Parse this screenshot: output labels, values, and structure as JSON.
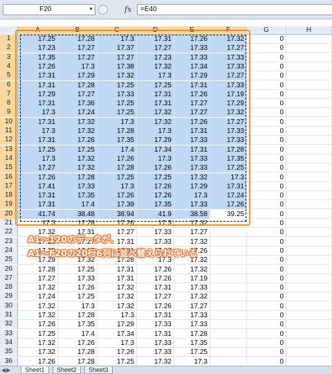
{
  "formula_bar": {
    "name_box": "F20",
    "fx_label": "fx",
    "formula": "=E40"
  },
  "columns": [
    "A",
    "B",
    "C",
    "D",
    "E",
    "F",
    "G",
    "H"
  ],
  "rows": [
    [
      "17.25",
      "17.28",
      "17.3",
      "17.31",
      "17.26",
      "17.32",
      "0"
    ],
    [
      "17.23",
      "17.27",
      "17.37",
      "17.27",
      "17.33",
      "17.27",
      "0"
    ],
    [
      "17.35",
      "17.27",
      "17.27",
      "17.23",
      "17.33",
      "17.33",
      "0"
    ],
    [
      "17.26",
      "17.3",
      "17.38",
      "17.32",
      "17.34",
      "17.33",
      "0"
    ],
    [
      "17.31",
      "17.29",
      "17.32",
      "17.3",
      "17.29",
      "17.27",
      "0"
    ],
    [
      "17.31",
      "17.28",
      "17.25",
      "17.25",
      "17.31",
      "17.33",
      "0"
    ],
    [
      "17.29",
      "17.27",
      "17.33",
      "17.31",
      "17.26",
      "17.19",
      "0"
    ],
    [
      "17.31",
      "17.36",
      "17.25",
      "17.31",
      "17.27",
      "17.29",
      "0"
    ],
    [
      "17.3",
      "17.24",
      "17.25",
      "17.32",
      "17.27",
      "17.32",
      "0"
    ],
    [
      "17.31",
      "17.32",
      "17.3",
      "17.32",
      "17.26",
      "17.27",
      "0"
    ],
    [
      "17.3",
      "17.32",
      "17.28",
      "17.3",
      "17.31",
      "17.33",
      "0"
    ],
    [
      "17.31",
      "17.26",
      "17.35",
      "17.29",
      "17.33",
      "17.33",
      "0"
    ],
    [
      "17.25",
      "17.25",
      "17.4",
      "17.34",
      "17.31",
      "17.28",
      "0"
    ],
    [
      "17.3",
      "17.32",
      "17.26",
      "17.3",
      "17.33",
      "17.35",
      "0"
    ],
    [
      "17.27",
      "17.32",
      "17.28",
      "17.26",
      "17.33",
      "17.25",
      "0"
    ],
    [
      "17.26",
      "17.28",
      "17.25",
      "17.25",
      "17.32",
      "17.3",
      "0"
    ],
    [
      "17.41",
      "17.33",
      "17.3",
      "17.26",
      "17.29",
      "17.31",
      "0"
    ],
    [
      "17.31",
      "17.35",
      "17.26",
      "17.26",
      "17.3",
      "17.24",
      "0"
    ],
    [
      "17.31",
      "17.4",
      "17.39",
      "17.35",
      "17.33",
      "17.26",
      "0"
    ],
    [
      "41.74",
      "38.48",
      "38.94",
      "41.9",
      "38.58",
      "39.25",
      "0"
    ],
    [
      "17.3",
      "17.28",
      "17.26",
      "17.3",
      "17.32",
      "",
      "0"
    ],
    [
      "17.32",
      "17.31",
      "17.27",
      "17.33",
      "17.27",
      "",
      "0"
    ],
    [
      "17.29",
      "17.27",
      "17.31",
      "17.33",
      "17.32",
      "",
      "0"
    ],
    [
      "17.25",
      "17.25",
      "17.31",
      "17.27",
      "17.26",
      "",
      "0"
    ],
    [
      "17.29",
      "17.32",
      "17.28",
      "17.3",
      "17.32",
      "",
      "0"
    ],
    [
      "17.28",
      "17.25",
      "17.31",
      "17.26",
      "17.32",
      "",
      "0"
    ],
    [
      "17.27",
      "17.33",
      "17.31",
      "17.26",
      "17.19",
      "",
      "0"
    ],
    [
      "17.32",
      "17.26",
      "17.32",
      "17.31",
      "17.33",
      "",
      "0"
    ],
    [
      "17.24",
      "17.25",
      "17.32",
      "17.27",
      "17.32",
      "",
      "0"
    ],
    [
      "17.32",
      "17.3",
      "17.32",
      "17.26",
      "17.27",
      "",
      "0"
    ],
    [
      "17.32",
      "17.28",
      "17.3",
      "17.31",
      "17.33",
      "",
      "0"
    ],
    [
      "17.26",
      "17.35",
      "17.29",
      "17.33",
      "17.33",
      "",
      "0"
    ],
    [
      "17.25",
      "17.4",
      "17.34",
      "17.31",
      "17.28",
      "",
      "0"
    ],
    [
      "17.32",
      "17.26",
      "17.3",
      "17.33",
      "17.35",
      "",
      "0"
    ],
    [
      "17.32",
      "17.28",
      "17.26",
      "17.33",
      "17.25",
      "",
      "0"
    ],
    [
      "17.26",
      "17.28",
      "17.25",
      "17.32",
      "17.3",
      "",
      "0"
    ]
  ],
  "annotation": {
    "line1": "A1～120のデータが、",
    "line2": "A1～F20の20行6列に並べ替えられている"
  },
  "sheet_tabs": [
    "Sheet1",
    "Sheet2",
    "Sheet3"
  ],
  "active_tab": "Sheet1",
  "colors": {
    "selection": "#bfd9f4",
    "header_highlight": "#f9d99f",
    "annotation_outline": "#e8722a",
    "box_outline": "#f08a2a"
  }
}
